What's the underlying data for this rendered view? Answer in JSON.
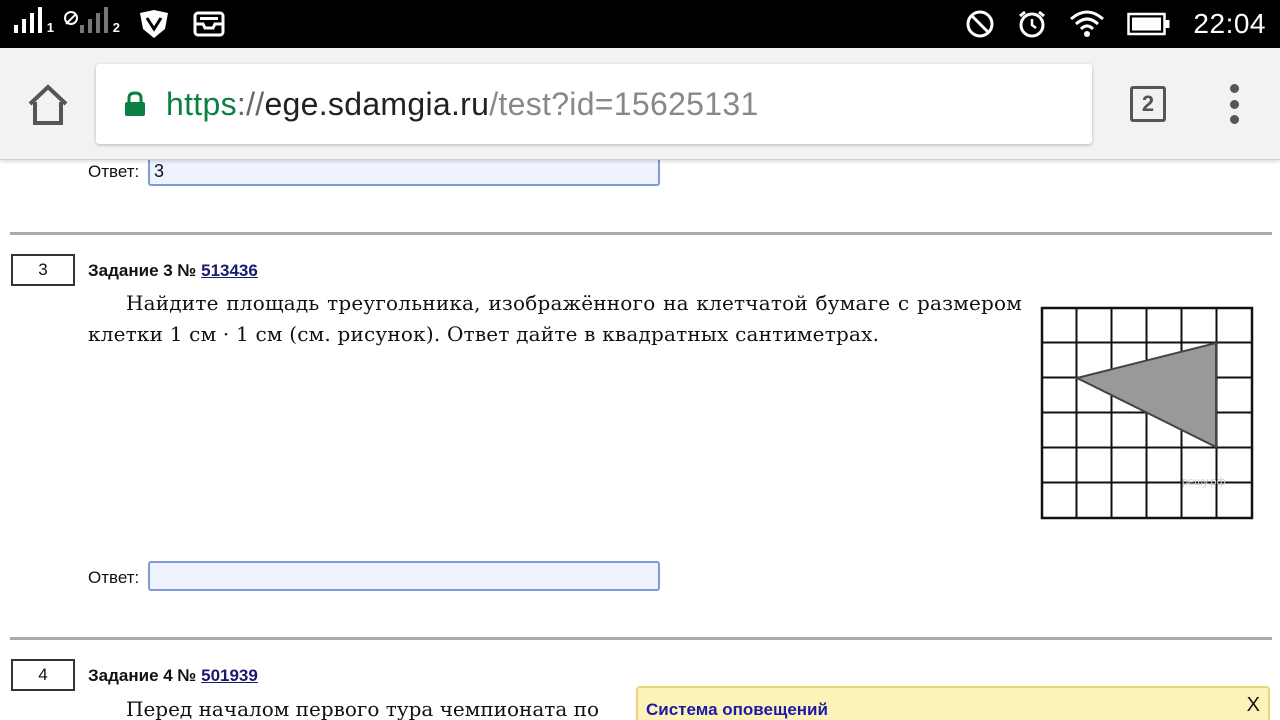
{
  "status_bar": {
    "sim1_label": "1",
    "sim2_label": "2",
    "time": "22:04",
    "icons": [
      "signal-icon",
      "no-signal-icon",
      "shield-icon",
      "inbox-icon",
      "do-not-disturb-icon",
      "alarm-icon",
      "wifi-icon",
      "battery-icon"
    ]
  },
  "browser": {
    "url_scheme": "https",
    "url_sep": "://",
    "url_host": "ege.sdamgia.ru",
    "url_path": "/test?id=15625131",
    "tab_count": "2"
  },
  "answer_label": "Ответ:",
  "task2": {
    "answer_value": "3"
  },
  "task3": {
    "number": "3",
    "heading": "Задание 3 № ",
    "id_link": "513436",
    "text": "Найдите площадь треугольника, изображённого на клетчатой бумаге с размером клетки 1 см · 1 см (см. рисунок). Ответ дайте в квадратных сантиметрах.",
    "answer_value": "",
    "watermark": "решу.рф"
  },
  "task4": {
    "number": "4",
    "heading": "Задание 4 № ",
    "id_link": "501939",
    "text": "Перед началом первого тура чемпионата по"
  },
  "notification": {
    "title": "Система оповещений",
    "close": "X"
  },
  "colors": {
    "status_bar_bg": "#000000",
    "url_scheme": "#0b8043",
    "link": "#1a1a6e",
    "input_bg": "#eef3ff",
    "notify_bg": "#fdf3b8",
    "triangle_fill": "#999999"
  }
}
